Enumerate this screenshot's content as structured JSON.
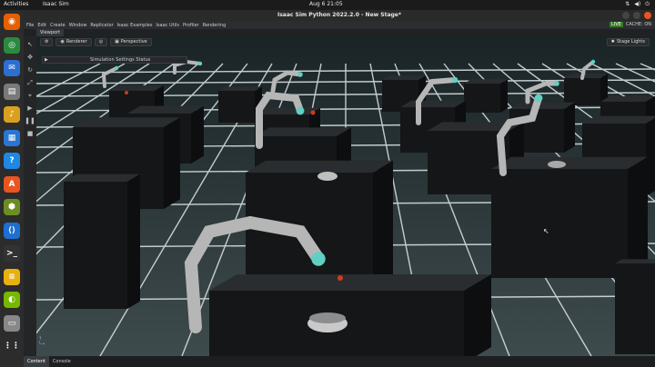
{
  "topbar": {
    "activities": "Activities",
    "app": "Isaac Sim",
    "clock": "Aug 6  21:05",
    "tray_icons": [
      "network-icon",
      "volume-icon",
      "power-icon"
    ]
  },
  "dock": {
    "items": [
      {
        "name": "firefox",
        "glyph": "◉",
        "color": "#e66000"
      },
      {
        "name": "chrome",
        "glyph": "◎",
        "color": "#2a8a3e"
      },
      {
        "name": "thunderbird",
        "glyph": "✉",
        "color": "#2d6fd1"
      },
      {
        "name": "files",
        "glyph": "▤",
        "color": "#7a7a7a"
      },
      {
        "name": "rhythmbox",
        "glyph": "♪",
        "color": "#d9a020"
      },
      {
        "name": "libreoffice",
        "glyph": "▦",
        "color": "#2b76d2"
      },
      {
        "name": "help",
        "glyph": "?",
        "color": "#1e88e5"
      },
      {
        "name": "software",
        "glyph": "A",
        "color": "#e95420"
      },
      {
        "name": "isaac-sim",
        "glyph": "⬢",
        "color": "#6b8e23"
      },
      {
        "name": "vscode",
        "glyph": "⟨⟩",
        "color": "#1f6fd1"
      },
      {
        "name": "terminal",
        "glyph": ">_",
        "color": "#333"
      },
      {
        "name": "notes",
        "glyph": "≡",
        "color": "#e8b10e"
      },
      {
        "name": "nvidia",
        "glyph": "◐",
        "color": "#76b900"
      },
      {
        "name": "disk",
        "glyph": "▭",
        "color": "#888"
      },
      {
        "name": "show-apps",
        "glyph": "⋮⋮",
        "color": "#2c2c2c"
      }
    ]
  },
  "window": {
    "title": "Isaac Sim Python 2022.2.0 - New Stage*"
  },
  "menu": {
    "items": [
      "File",
      "Edit",
      "Create",
      "Window",
      "Replicator",
      "Isaac Examples",
      "Isaac Utils",
      "Profiler",
      "Rendering"
    ],
    "live": "LIVE",
    "cache": "CACHE: ON"
  },
  "viewport": {
    "tab": "Viewport",
    "renderer": "Renderer",
    "perspective": "Perspective",
    "stage_lights": "Stage Lights",
    "sim_status_title": "Simulation Settings Status"
  },
  "bottom_tabs": [
    {
      "label": "Content"
    },
    {
      "label": "Console"
    }
  ]
}
